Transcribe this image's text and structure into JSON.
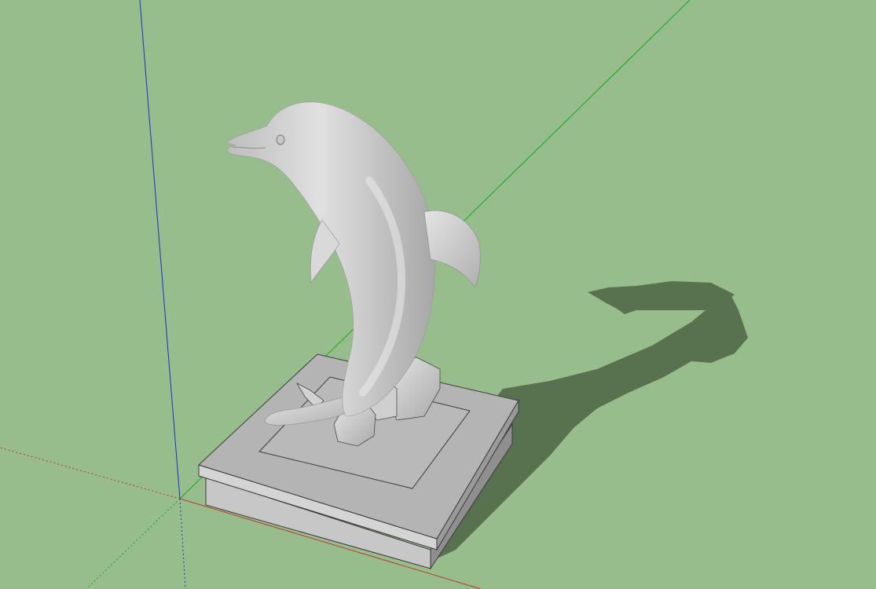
{
  "viewport": {
    "background": "#97bd8c",
    "axes": {
      "red": "#c0392b",
      "green": "#11a821",
      "blue": "#1f2fc4"
    },
    "model": {
      "subject": "dolphin-statue",
      "material_light": "#dcdcdc",
      "material_mid": "#c4c4c4",
      "material_dark": "#9d9d9d",
      "edge": "#3a3a3a",
      "shadow": "#58714f"
    }
  }
}
